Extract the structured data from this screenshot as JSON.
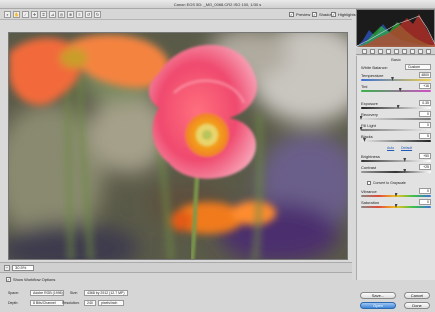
{
  "window": {
    "title": "Canon EOS 5D: _MG_0068.CR2  ISO 100, 1/30 s"
  },
  "toolbar": {
    "tools": [
      {
        "name": "zoom-tool",
        "glyph": "⌕"
      },
      {
        "name": "hand-tool",
        "glyph": "✋"
      },
      {
        "name": "white-balance-tool",
        "glyph": "⁄"
      },
      {
        "name": "color-sampler-tool",
        "glyph": "✛"
      },
      {
        "name": "crop-tool",
        "glyph": "⌗"
      },
      {
        "name": "straighten-tool",
        "glyph": "⊿"
      },
      {
        "name": "retouch-tool",
        "glyph": "◎"
      },
      {
        "name": "red-eye-tool",
        "glyph": "⊕"
      },
      {
        "name": "preferences-tool",
        "glyph": "≡"
      },
      {
        "name": "rotate-left-tool",
        "glyph": "↺"
      },
      {
        "name": "rotate-right-tool",
        "glyph": "↻"
      }
    ],
    "preview_label": "Preview",
    "shadows_label": "Shadows",
    "highlights_label": "Highlights"
  },
  "status": {
    "zoom": "30.5%",
    "zoom_minus": "−"
  },
  "histogram": {
    "colors": [
      "#d9342b",
      "#2cbf3a",
      "#2f5fe0",
      "#cfcfcf"
    ]
  },
  "panel": {
    "title": "Basic",
    "white_balance": {
      "label": "White Balance:",
      "value": "Custom"
    },
    "temperature": {
      "label": "Temperature",
      "value": "4800",
      "level": 0.45
    },
    "tint": {
      "label": "Tint",
      "value": "+16",
      "level": 0.56
    },
    "auto_label": "Auto",
    "default_label": "Default",
    "exposure": {
      "label": "Exposure",
      "value": "0.35",
      "level": 0.53
    },
    "recovery": {
      "label": "Recovery",
      "value": "0",
      "level": 0.0
    },
    "fill_light": {
      "label": "Fill Light",
      "value": "0",
      "level": 0.0
    },
    "blacks": {
      "label": "Blacks",
      "value": "5",
      "level": 0.05
    },
    "brightness": {
      "label": "Brightness",
      "value": "+50",
      "level": 0.625
    },
    "contrast": {
      "label": "Contrast",
      "value": "+25",
      "level": 0.625
    },
    "convert_grayscale_label": "Convert to Grayscale",
    "vibrance": {
      "label": "Vibrance",
      "value": "0",
      "level": 0.5
    },
    "saturation": {
      "label": "Saturation",
      "value": "0",
      "level": 0.5
    }
  },
  "workflow": {
    "show_label": "Show Workflow Options",
    "space": {
      "label": "Space:",
      "value": "Adobe RGB (1998)"
    },
    "depth": {
      "label": "Depth:",
      "value": "8 Bits/Channel"
    },
    "size": {
      "label": "Size:",
      "value": "4368 by 2912 (12.7 MP)"
    },
    "resolution": {
      "label": "Resolution:",
      "value": "240",
      "unit": "pixels/inch"
    }
  },
  "buttons": {
    "save": "Save...",
    "cancel": "Cancel",
    "open": "Open",
    "done": "Done"
  }
}
